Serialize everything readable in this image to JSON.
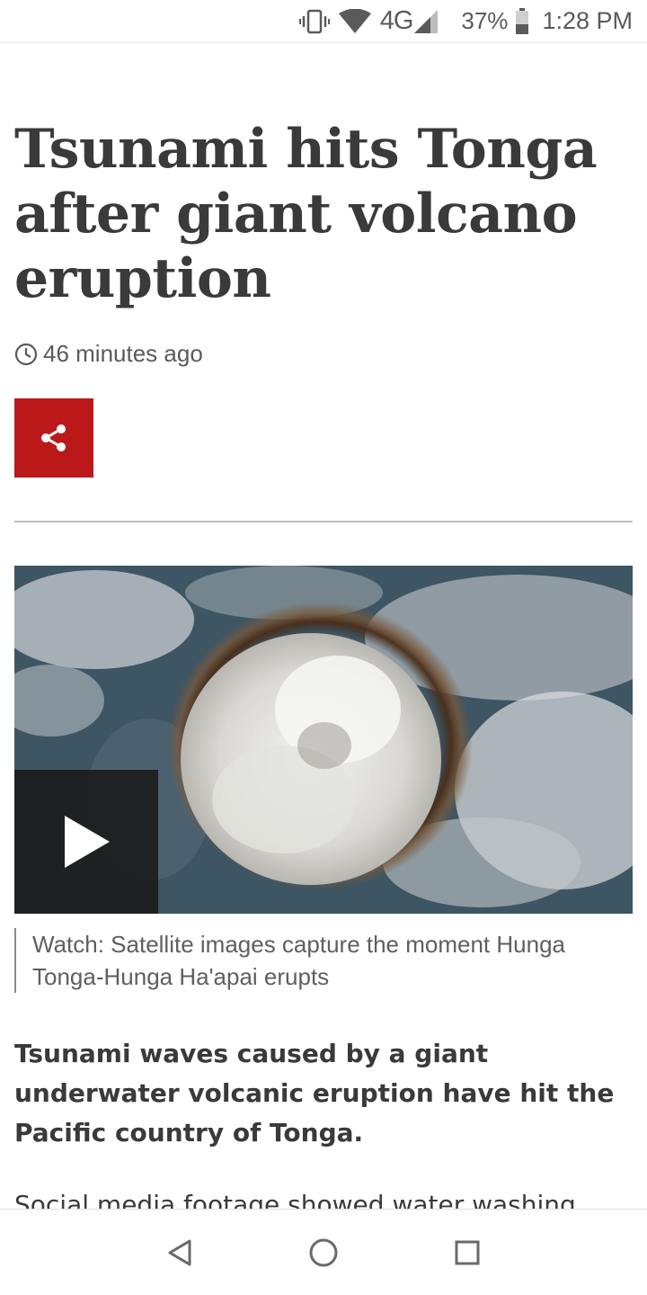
{
  "status_bar": {
    "network": "4G",
    "battery": "37%",
    "time": "1:28 PM",
    "icons": [
      "vibrate-icon",
      "wifi-icon",
      "signal-icon",
      "battery-icon"
    ]
  },
  "article": {
    "headline": "Tsunami hits Tonga after giant volcano eruption",
    "timestamp": "46 minutes ago",
    "share_icon": "share-icon",
    "media": {
      "caption": "Watch: Satellite images capture the moment Hunga Tonga-Hunga Ha'apai erupts",
      "play_icon": "play-icon"
    },
    "intro": "Tsunami waves caused by a giant underwater volcanic eruption have hit the Pacific country of Tonga.",
    "body": "Social media footage showed water washing"
  },
  "nav_bar": {
    "icons": [
      "back-icon",
      "home-icon",
      "recents-icon"
    ]
  },
  "colors": {
    "accent": "#bb1919",
    "text": "#3a3a3a",
    "secondary_text": "#5f5f5f"
  }
}
